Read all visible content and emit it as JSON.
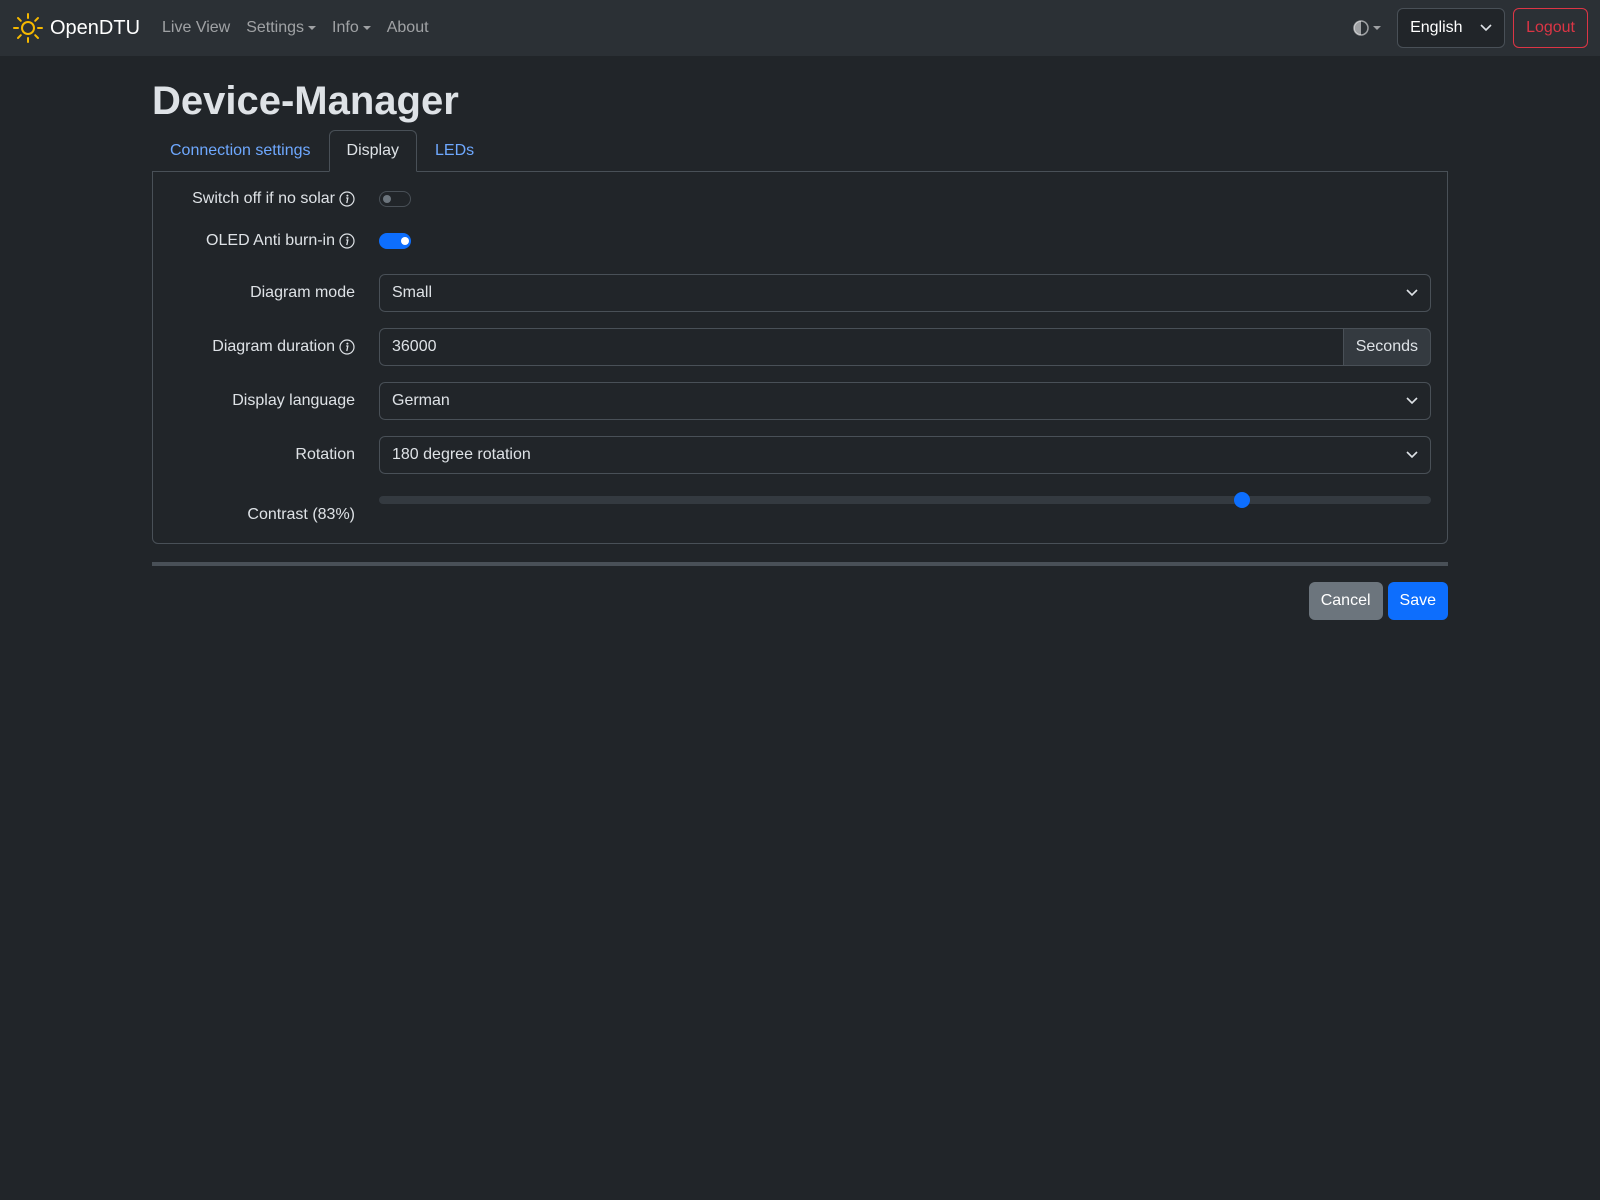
{
  "navbar": {
    "brand": "OpenDTU",
    "items": [
      {
        "label": "Live View",
        "dropdown": false
      },
      {
        "label": "Settings",
        "dropdown": true
      },
      {
        "label": "Info",
        "dropdown": true
      },
      {
        "label": "About",
        "dropdown": false
      }
    ],
    "language": "English",
    "logout_label": "Logout"
  },
  "page": {
    "title": "Device-Manager",
    "tabs": [
      "Connection settings",
      "Display",
      "LEDs"
    ],
    "active_tab": 1
  },
  "form": {
    "switch_off_label": "Switch off if no solar",
    "switch_off_value": false,
    "anti_burn_label": "OLED Anti burn-in",
    "anti_burn_value": true,
    "diagram_mode_label": "Diagram mode",
    "diagram_mode_value": "Small",
    "diagram_duration_label": "Diagram duration",
    "diagram_duration_value": "36000",
    "diagram_duration_unit": "Seconds",
    "display_language_label": "Display language",
    "display_language_value": "German",
    "rotation_label": "Rotation",
    "rotation_value": "180 degree rotation",
    "contrast_label": "Contrast (83%)",
    "contrast_value": 0.825
  },
  "actions": {
    "cancel_label": "Cancel",
    "save_label": "Save"
  },
  "colors": {
    "accent": "#0d6efd",
    "danger": "#dc3545",
    "link": "#6ea8fe",
    "brand_icon": "#f5b800"
  }
}
